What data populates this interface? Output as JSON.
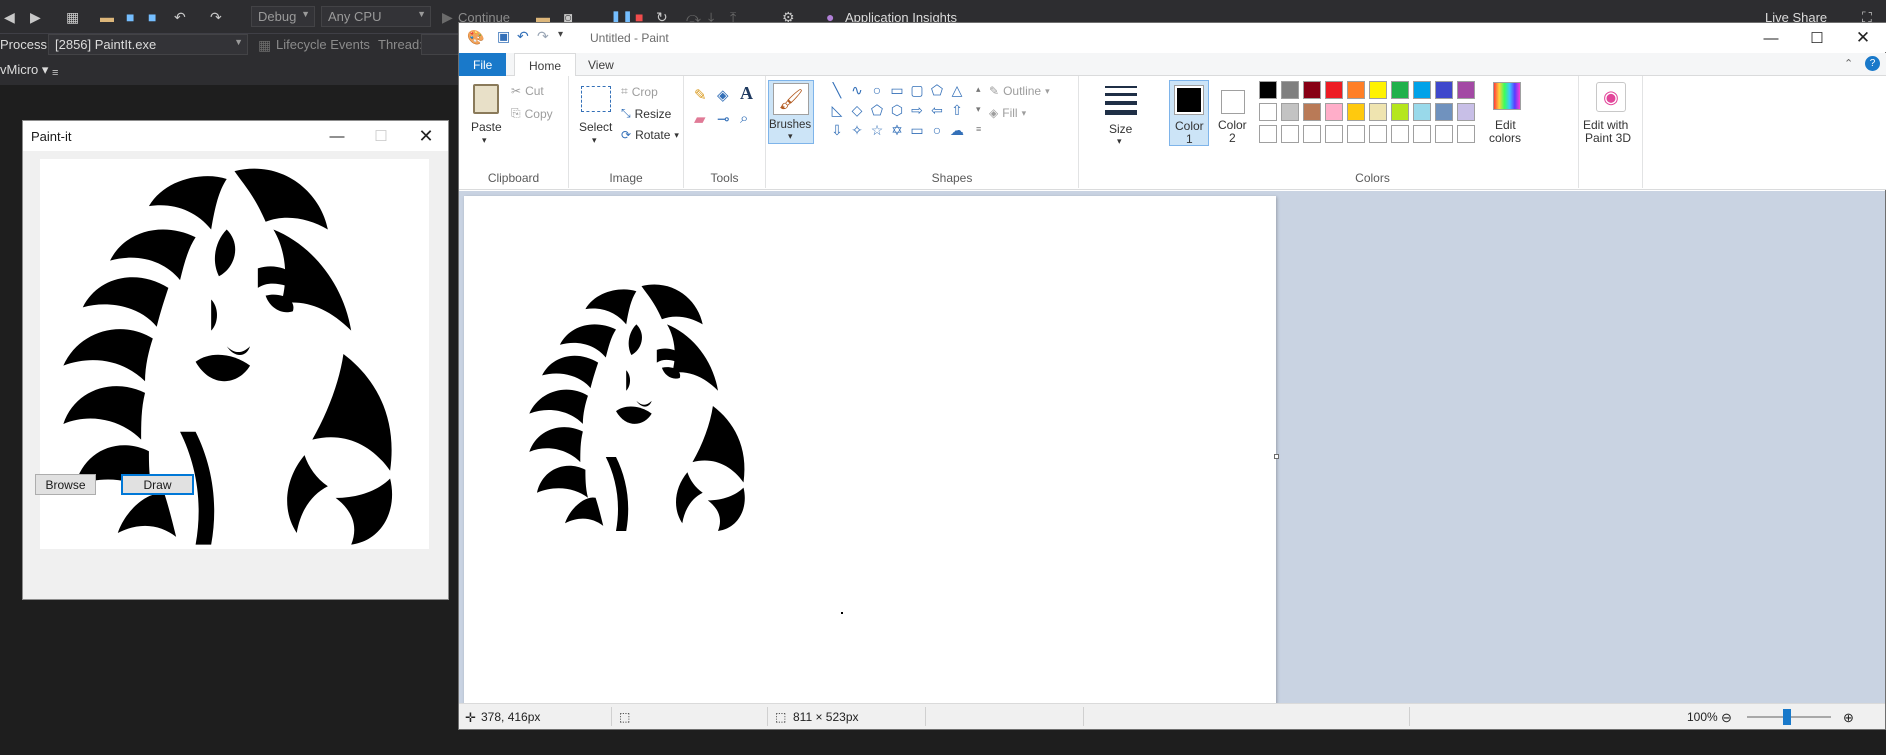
{
  "vs": {
    "debug_config": "Debug",
    "platform": "Any CPU",
    "continue_label": "Continue",
    "app_insights": "Application Insights",
    "live_share": "Live Share",
    "process_label": "Process:",
    "process_value": "[2856] PaintIt.exe",
    "lifecycle_events": "Lifecycle Events",
    "thread_label": "Thread:",
    "vmicro_label": "vMicro"
  },
  "paintit": {
    "title": "Paint-it",
    "browse_label": "Browse",
    "draw_label": "Draw"
  },
  "paint": {
    "title": "Untitled - Paint",
    "tabs": [
      "File",
      "Home",
      "View"
    ],
    "clipboard": {
      "paste": "Paste",
      "cut": "Cut",
      "copy": "Copy",
      "group": "Clipboard"
    },
    "image": {
      "select": "Select",
      "crop": "Crop",
      "resize": "Resize",
      "rotate": "Rotate",
      "group": "Image"
    },
    "tools": {
      "group": "Tools"
    },
    "brushes": {
      "label": "Brushes"
    },
    "shapes": {
      "outline": "Outline",
      "fill": "Fill",
      "group": "Shapes"
    },
    "size_label": "Size",
    "color1": {
      "line1": "Color",
      "line2": "1"
    },
    "color2": {
      "line1": "Color",
      "line2": "2"
    },
    "colors_group": "Colors",
    "edit_colors": {
      "line1": "Edit",
      "line2": "colors"
    },
    "paint3d": {
      "line1": "Edit with",
      "line2": "Paint 3D"
    },
    "palette_row1": [
      "#000000",
      "#7f7f7f",
      "#880015",
      "#ed1c24",
      "#ff7f27",
      "#fff200",
      "#22b14c",
      "#00a2e8",
      "#3f48cc",
      "#a349a4"
    ],
    "palette_row2": [
      "#ffffff",
      "#c3c3c3",
      "#b97a57",
      "#ffaec9",
      "#ffc90e",
      "#efe4b0",
      "#b5e61d",
      "#99d9ea",
      "#7092be",
      "#c8bfe7"
    ],
    "status": {
      "cursor_pos": "378, 416px",
      "canvas_size": "811 × 523px",
      "zoom": "100%"
    }
  }
}
